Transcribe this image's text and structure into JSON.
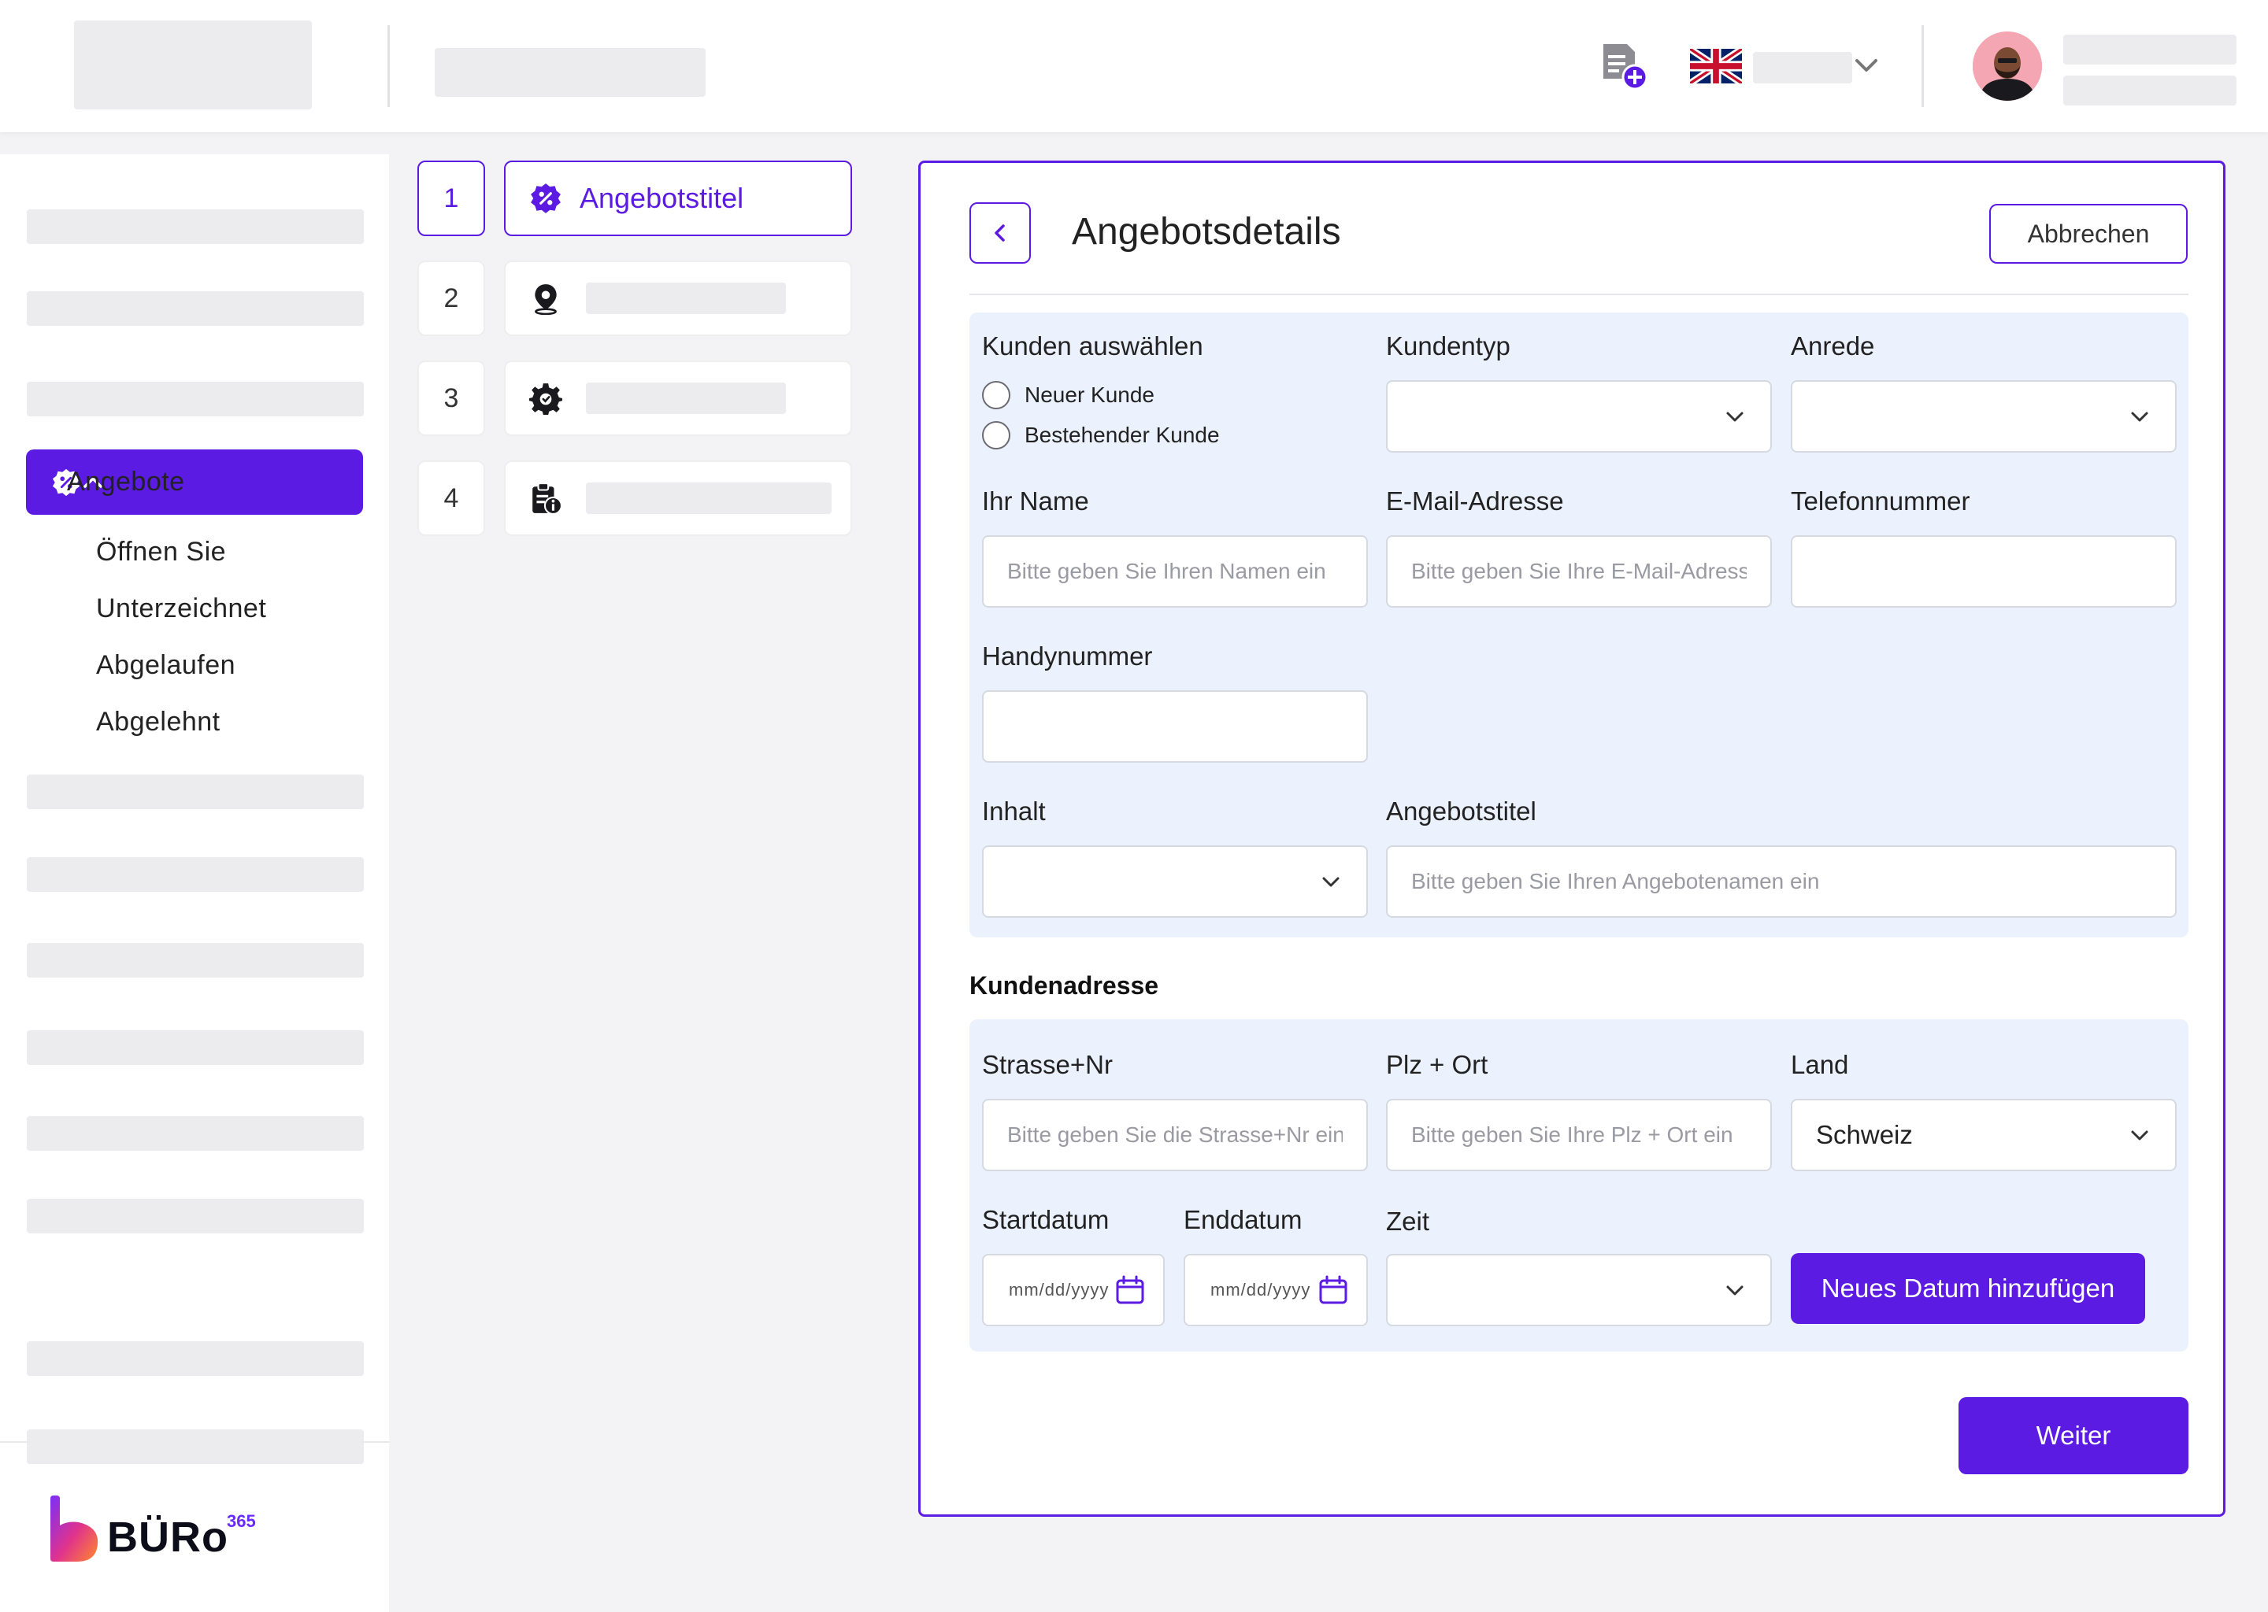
{
  "language": {
    "flag": "uk-flag-icon"
  },
  "sidebar": {
    "active_item": {
      "label": "Angebote",
      "icon": "percent-badge-icon"
    },
    "sub_items": [
      "Öffnen Sie",
      "Unterzeichnet",
      "Abgelaufen",
      "Abgelehnt"
    ],
    "brand": {
      "name": "BÜRo",
      "superscript": "365"
    }
  },
  "steps": [
    {
      "number": "1",
      "label": "Angebotstitel",
      "icon": "percent-badge-icon",
      "active": true
    },
    {
      "number": "2",
      "label": "",
      "icon": "map-pin-icon",
      "active": false
    },
    {
      "number": "3",
      "label": "",
      "icon": "gear-icon",
      "active": false
    },
    {
      "number": "4",
      "label": "",
      "icon": "clipboard-info-icon",
      "active": false
    }
  ],
  "form": {
    "title": "Angebotsdetails",
    "cancel_label": "Abbrechen",
    "customer_select_label": "Kunden auswählen",
    "radio_new": "Neuer Kunde",
    "radio_existing": "Bestehender Kunde",
    "customer_type_label": "Kundentyp",
    "salutation_label": "Anrede",
    "name_label": "Ihr Name",
    "name_placeholder": "Bitte geben Sie Ihren Namen ein",
    "email_label": "E-Mail-Adresse",
    "email_placeholder": "Bitte geben Sie Ihre E-Mail-Adresse ein",
    "phone_label": "Telefonnummer",
    "mobile_label": "Handynummer",
    "content_label": "Inhalt",
    "offer_title_label": "Angebotstitel",
    "offer_title_placeholder": "Bitte geben Sie Ihren Angebotenamen ein",
    "address_heading": "Kundenadresse",
    "street_label": "Strasse+Nr",
    "street_placeholder": "Bitte geben Sie die Strasse+Nr ein",
    "zip_label": "Plz + Ort",
    "zip_placeholder": "Bitte geben Sie Ihre Plz + Ort ein",
    "country_label": "Land",
    "country_value": "Schweiz",
    "start_label": "Startdatum",
    "end_label": "Enddatum",
    "time_label": "Zeit",
    "date_placeholder": "mm/dd/yyyy",
    "add_date_label": "Neues Datum hinzufügen",
    "next_label": "Weiter"
  },
  "colors": {
    "accent": "#5b1be2",
    "panel_bg": "#ecf2fd"
  }
}
